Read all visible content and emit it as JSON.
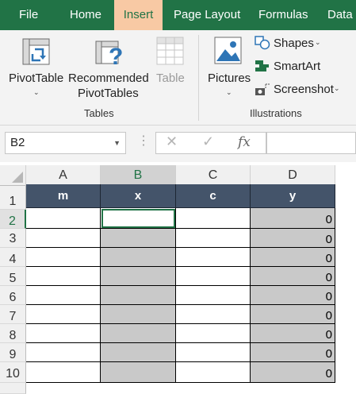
{
  "ribbon_tabs": [
    {
      "label": "File"
    },
    {
      "label": "Home"
    },
    {
      "label": "Insert"
    },
    {
      "label": "Page Layout"
    },
    {
      "label": "Formulas"
    },
    {
      "label": "Data"
    }
  ],
  "ribbon": {
    "pivot_table": "PivotTable",
    "recommended_1": "Recommended",
    "recommended_2": "PivotTables",
    "table": "Table",
    "tables_group": "Tables",
    "pictures": "Pictures",
    "shapes": "Shapes",
    "smartart": "SmartArt",
    "screenshot": "Screenshot",
    "illustrations_group": "Illustrations"
  },
  "formula_bar": {
    "name_box": "B2",
    "fx": "fx",
    "formula": ""
  },
  "columns": [
    "A",
    "B",
    "C",
    "D"
  ],
  "rows": [
    "1",
    "2",
    "3",
    "4",
    "5",
    "6",
    "7",
    "8",
    "9",
    "10"
  ],
  "table": {
    "headers": [
      "m",
      "x",
      "c",
      "y"
    ],
    "y_values": [
      "0",
      "0",
      "0",
      "0",
      "0",
      "0",
      "0",
      "0",
      "0"
    ]
  },
  "colors": {
    "ribbon_green": "#217346",
    "active_tab": "#f8c9a4",
    "header_fill": "#44546a",
    "gray_fill": "#c9c9c9"
  }
}
